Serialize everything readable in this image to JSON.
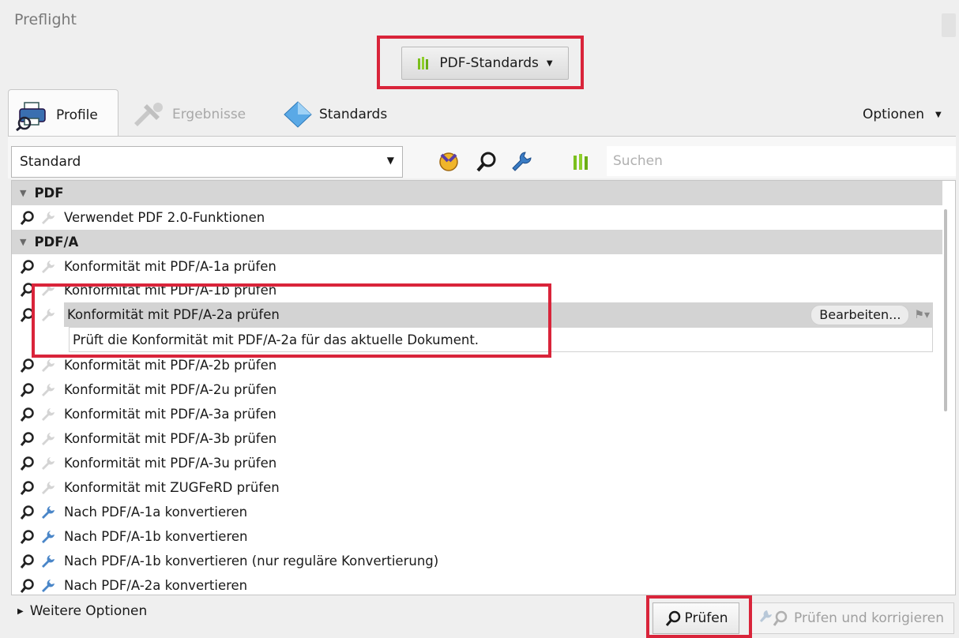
{
  "window": {
    "title": "Preflight"
  },
  "top_button": {
    "label": "PDF-Standards"
  },
  "tabs": [
    {
      "label": "Profile"
    },
    {
      "label": "Ergebnisse"
    },
    {
      "label": "Standards"
    }
  ],
  "options_label": "Optionen",
  "profile_select": {
    "value": "Standard"
  },
  "search": {
    "placeholder": "Suchen"
  },
  "list": {
    "groups": [
      {
        "label": "PDF"
      },
      {
        "label": "PDF/A"
      }
    ],
    "items": [
      "Verwendet PDF 2.0-Funktionen",
      "Konformität mit PDF/A-1a prüfen",
      "Konformität mit PDF/A-1b prüfen",
      "Konformität mit PDF/A-2a prüfen",
      "Konformität mit PDF/A-2b prüfen",
      "Konformität mit PDF/A-2u prüfen",
      "Konformität mit PDF/A-3a prüfen",
      "Konformität mit PDF/A-3b prüfen",
      "Konformität mit PDF/A-3u prüfen",
      "Konformität mit ZUGFeRD prüfen",
      "Nach PDF/A-1a konvertieren",
      "Nach PDF/A-1b konvertieren",
      "Nach PDF/A-1b konvertieren (nur reguläre Konvertierung)",
      "Nach PDF/A-2a konvertieren"
    ],
    "selected_description": "Prüft die Konformität mit PDF/A-2a für das aktuelle Dokument.",
    "edit_button": "Bearbeiten..."
  },
  "bottom": {
    "more_options": "Weitere Optionen",
    "pruefen": "Prüfen",
    "pruefen_korrigieren": "Prüfen und korrigieren"
  },
  "colors": {
    "highlight": "#d9243a",
    "selected_row": "#d3d3d3",
    "group_row": "#d6d6d6"
  }
}
